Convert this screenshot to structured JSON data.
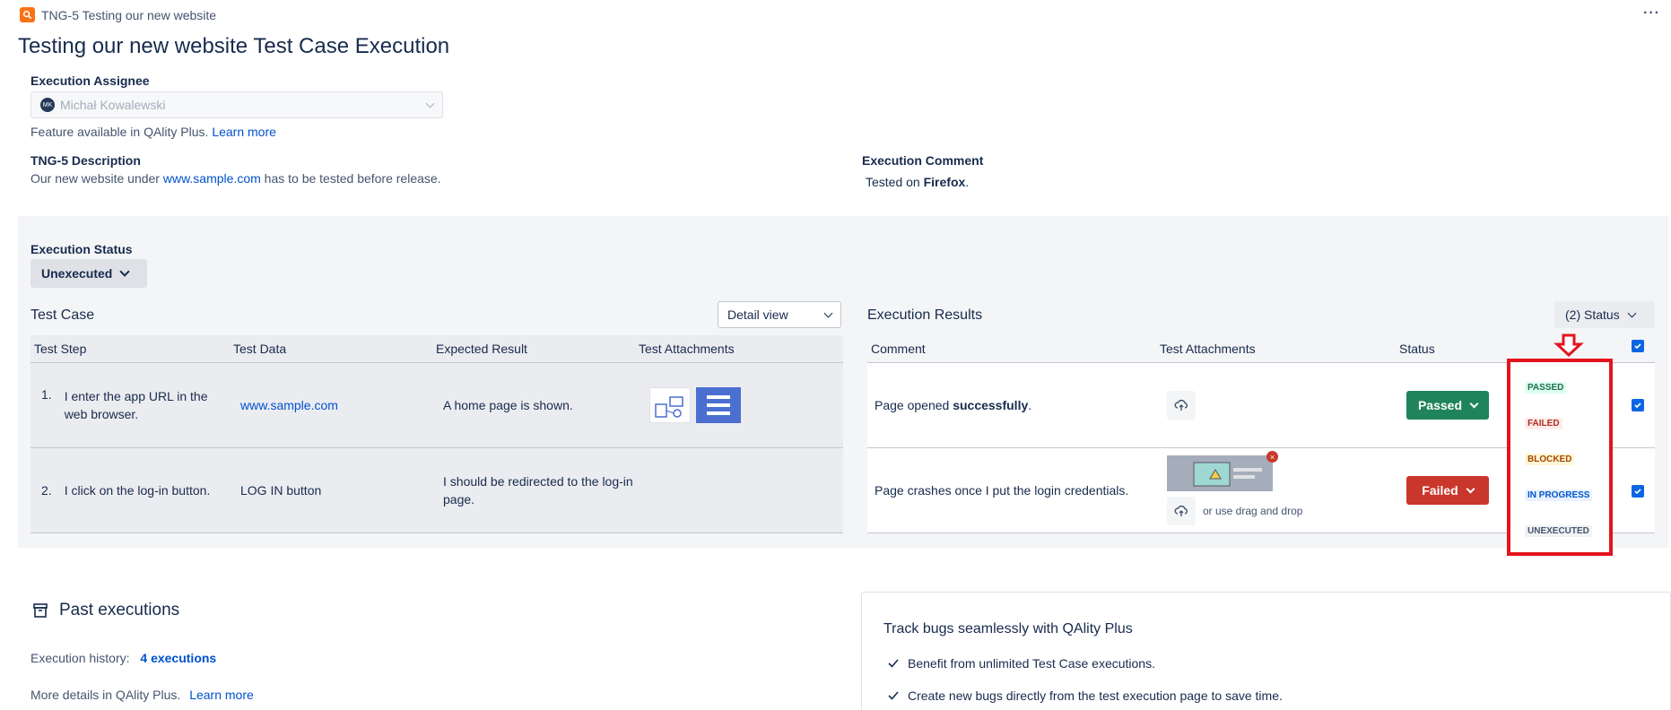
{
  "header": {
    "issue_key": "TNG-5 Testing our new website",
    "title": "Testing our new website Test Case Execution",
    "more_label": "···"
  },
  "assignee": {
    "label": "Execution Assignee",
    "avatar_initials": "MK",
    "value": "Michał Kowalewski",
    "feature_note": "Feature available in QAlity Plus.",
    "learn_more": "Learn more"
  },
  "description": {
    "label": "TNG-5 Description",
    "text_before": "Our new website under",
    "link": "www.sample.com",
    "text_after": "has to be tested before release."
  },
  "execution_comment": {
    "label": "Execution Comment",
    "text_before": "Tested on",
    "bold": "Firefox",
    "text_after": "."
  },
  "execution_status": {
    "label": "Execution Status",
    "value": "Unexecuted"
  },
  "test_case": {
    "title": "Test Case",
    "view_select": "Detail view",
    "columns": [
      "Test Step",
      "Test Data",
      "Expected Result",
      "Test Attachments"
    ],
    "rows": [
      {
        "num": "1.",
        "step": "I enter the app URL in the web browser.",
        "data": "www.sample.com",
        "expected": "A home page is shown."
      },
      {
        "num": "2.",
        "step": "I click on the log-in button.",
        "data": "LOG IN button",
        "expected": "I should be redirected to the log-in page."
      }
    ]
  },
  "execution_results": {
    "title": "Execution Results",
    "status_filter": "(2) Status",
    "columns": [
      "Comment",
      "Test Attachments",
      "Status"
    ],
    "rows": [
      {
        "comment_before": "Page opened",
        "comment_bold": "successfully",
        "comment_after": ".",
        "status": "Passed"
      },
      {
        "comment_before": "Page crashes once I put the login credentials.",
        "comment_bold": "",
        "comment_after": "",
        "status": "Failed",
        "drag_drop": "or use drag and drop"
      }
    ]
  },
  "status_dropdown": {
    "options": [
      "PASSED",
      "FAILED",
      "BLOCKED",
      "IN PROGRESS",
      "UNEXECUTED"
    ],
    "highlight_color": "#e3141e"
  },
  "past_executions": {
    "title": "Past executions",
    "history_label": "Execution history:",
    "history_link": "4 executions",
    "more_details": "More details in QAlity Plus.",
    "learn_more": "Learn more"
  },
  "promo": {
    "title": "Track bugs seamlessly with QAlity Plus",
    "items": [
      "Benefit from unlimited Test Case executions.",
      "Create new bugs directly from the test execution page to save time."
    ]
  },
  "colors": {
    "passed": "#1f845a",
    "failed": "#c9372c",
    "link": "#0052cc",
    "issue_icon": "#f97316"
  }
}
